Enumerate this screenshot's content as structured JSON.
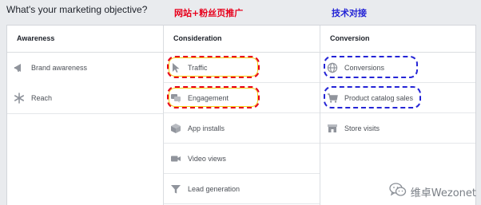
{
  "header": {
    "question": "What's your marketing objective?"
  },
  "annotations": {
    "left_note": "网站+粉丝页推广",
    "right_note": "技术对接",
    "left_color": "#e8001c",
    "right_color": "#2424d6"
  },
  "columns": [
    {
      "title": "Awareness",
      "items": [
        {
          "label": "Brand awareness",
          "icon": "megaphone-icon"
        },
        {
          "label": "Reach",
          "icon": "snowflake-icon"
        }
      ]
    },
    {
      "title": "Consideration",
      "items": [
        {
          "label": "Traffic",
          "icon": "cursor-icon",
          "highlight": "red"
        },
        {
          "label": "Engagement",
          "icon": "chat-bubbles-icon",
          "highlight": "red"
        },
        {
          "label": "App installs",
          "icon": "cube-icon"
        },
        {
          "label": "Video views",
          "icon": "video-camera-icon"
        },
        {
          "label": "Lead generation",
          "icon": "funnel-icon"
        }
      ]
    },
    {
      "title": "Conversion",
      "items": [
        {
          "label": "Conversions",
          "icon": "globe-icon",
          "highlight": "blue"
        },
        {
          "label": "Product catalog sales",
          "icon": "shopping-cart-icon",
          "highlight": "blue"
        },
        {
          "label": "Store visits",
          "icon": "store-icon"
        }
      ]
    }
  ],
  "watermark": {
    "text": "维卓Wezonet",
    "icon": "wechat-icon"
  },
  "colors": {
    "page_bg": "#e9ebee",
    "icon": "#90949c",
    "label": "#4b4f56"
  }
}
